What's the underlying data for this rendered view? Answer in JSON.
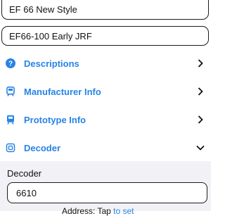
{
  "fields": [
    {
      "value": "EF 66 New Style"
    },
    {
      "value": "EF66-100 Early JRF"
    }
  ],
  "menu": {
    "items": [
      {
        "label": "Descriptions",
        "icon": "question-circle-icon",
        "chevron": "chevron-right-icon"
      },
      {
        "label": "Manufacturer Info",
        "icon": "train-icon",
        "chevron": "chevron-right-icon"
      },
      {
        "label": "Prototype Info",
        "icon": "train-icon",
        "chevron": "chevron-right-icon"
      },
      {
        "label": "Decoder",
        "icon": "chip-icon",
        "chevron": "chevron-down-icon"
      }
    ]
  },
  "decoder_section": {
    "title": "Decoder",
    "value": "6610",
    "footer_text": "Address: Tap ",
    "footer_link": "to set"
  },
  "colors": {
    "accent": "#2783e6",
    "section_bg": "#f2f2f6",
    "text": "#111111"
  }
}
